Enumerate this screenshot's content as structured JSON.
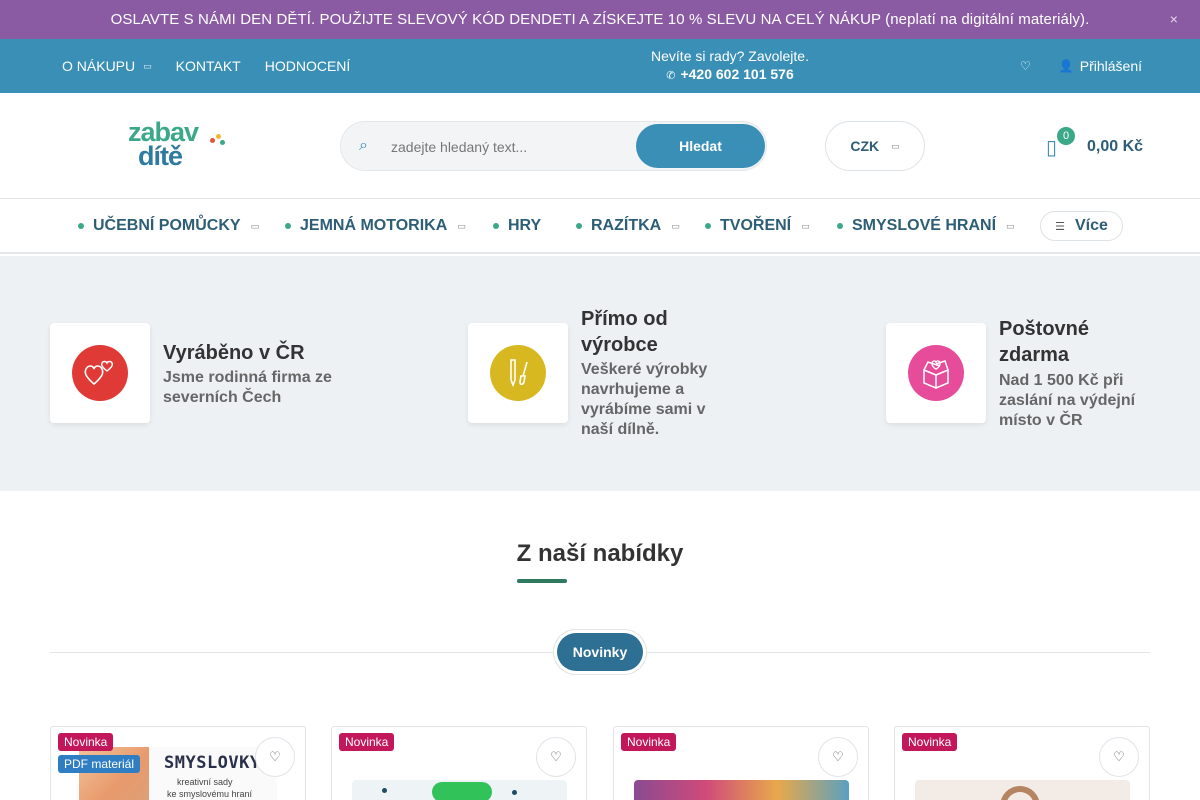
{
  "promo": {
    "text": "OSLAVTE S NÁMI DEN DĚTÍ. POUŽIJTE SLEVOVÝ KÓD DENDETI A ZÍSKEJTE 10 % SLEVU NA CELÝ NÁKUP (neplatí na digitální materiály).",
    "close_icon": "×",
    "bg_color": "#8a5aa3"
  },
  "topbar": {
    "nav": [
      {
        "label": "O NÁKUPU",
        "has_dropdown": true
      },
      {
        "label": "KONTAKT",
        "has_dropdown": false
      },
      {
        "label": "HODNOCENÍ",
        "has_dropdown": false
      }
    ],
    "help_text": "Nevíte si rady? Zavolejte.",
    "phone": "+420 602 101 576",
    "phone_icon": "phone-icon",
    "login_label": "Přihlášení",
    "bg_color": "#3a8fb7"
  },
  "header": {
    "logo_line1": "zabav",
    "logo_line2": "dítě",
    "search_placeholder": "zadejte hledaný text...",
    "search_button": "Hledat",
    "currency": "CZK",
    "cart_count": "0",
    "cart_total": "0,00 Kč"
  },
  "categories": [
    {
      "label": "UČEBNÍ POMŮCKY",
      "has_dropdown": true
    },
    {
      "label": "JEMNÁ MOTORIKA",
      "has_dropdown": true
    },
    {
      "label": "HRY",
      "has_dropdown": false
    },
    {
      "label": "RAZÍTKA",
      "has_dropdown": true
    },
    {
      "label": "TVOŘENÍ",
      "has_dropdown": true
    },
    {
      "label": "SMYSLOVÉ HRANÍ",
      "has_dropdown": true
    }
  ],
  "more_label": "Více",
  "benefits": [
    {
      "title": "Vyráběno v ČR",
      "desc": "Jsme rodinná firma ze severních Čech",
      "icon": "hearts-icon",
      "color": "#e03a36"
    },
    {
      "title": "Přímo od výrobce",
      "desc": "Veškeré výrobky navrhujeme a vyrábíme sami v naší dílně.",
      "icon": "pencil-brush-icon",
      "color": "#d8b820"
    },
    {
      "title": "Poštovné zdarma",
      "desc": "Nad 1 500 Kč při zaslání na výdejní místo v ČR",
      "icon": "package-icon",
      "color": "#e64c9a"
    }
  ],
  "offer": {
    "title": "Z naší nabídky",
    "tab_active": "Novinky"
  },
  "products": [
    {
      "flag_new": "Novinka",
      "flag_pdf": "PDF materiál",
      "image_text_1": "SMYSLOVKY",
      "image_text_2": "kreativní sady",
      "image_text_3": "ke smyslovému hraní"
    },
    {
      "flag_new": "Novinka"
    },
    {
      "flag_new": "Novinka"
    },
    {
      "flag_new": "Novinka"
    }
  ]
}
